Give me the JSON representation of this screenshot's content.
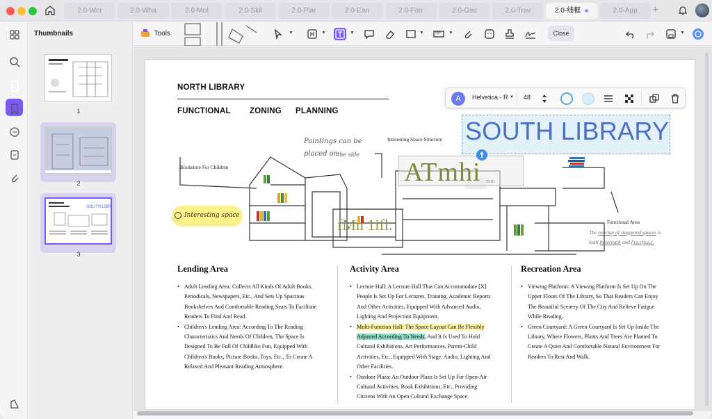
{
  "tabs": [
    {
      "label": "2.0-Wor"
    },
    {
      "label": "2.0-Wha"
    },
    {
      "label": "2.0-Mot"
    },
    {
      "label": "2.0-Skil"
    },
    {
      "label": "2.0-Plar"
    },
    {
      "label": "2.0-Earr"
    },
    {
      "label": "2.0-Forr"
    },
    {
      "label": "2.0-Gec"
    },
    {
      "label": "2.0-Trav"
    },
    {
      "label": "2.0-线框"
    },
    {
      "label": "2.0-App"
    }
  ],
  "sidebar": {
    "title": "Thumbnails",
    "pages": [
      "1",
      "2",
      "3"
    ]
  },
  "toolbar": {
    "tools_label": "Tools",
    "close_label": "Close"
  },
  "format_bar": {
    "font": "Helvetica - R",
    "size": "48",
    "avatar_letter": "A"
  },
  "doc": {
    "title": "NORTH LIBRARY",
    "subtitle": [
      "FUNCTIONAL",
      "ZONING",
      "PLANNING"
    ],
    "south_text": "SOUTH LIBRARY",
    "overlay_big": "ATmhi",
    "overlay_small": "mm",
    "overlay_mid": "fMn 1ifl.",
    "labels": {
      "bookstore": "Bookstore For Children",
      "paintings_1": "Paintings can be",
      "paintings_2": "placed on",
      "paintings_3": "the side",
      "interesting_struct": "Interesting Space Structure",
      "functional": "Functional Area",
      "interesting_space": "Interesting space",
      "overlap_1": "The",
      "overlap_2": "overlap of staggered spaces",
      "overlap_3": "is",
      "overlap_4": "both",
      "overlap_5": "ih-terestih",
      "overlap_6": "and",
      "overlap_7": "f'ra.cfica.l."
    },
    "sections": [
      {
        "heading": "Lending Area",
        "items": [
          "Adult Lending Area: Collects All Kinds Of Adult Books, Periodicals, Newspapers, Etc., And Sets Up Spacious Bookshelves And Comfortable Reading Seats To Facilitate Readers To Find And Read.",
          "Children's Lending Area: According To The Reading Characteristics And Needs Of Children, The Space Is Designed To Be Full Of Childlike Fun, Equipped With Children's Books, Picture Books, Toys, Etc., To Create A Relaxed And Pleasant Reading Atmosphere."
        ]
      },
      {
        "heading": "Activity Area",
        "items": [
          "Lecture Hall: A Lecture Hall That Can Accommodate [X] People Is Set Up For Lectures, Training, Academic Reports And Other Activities, Equipped With Advanced Audio, Lighting And Projection Equipment.",
          "HIGHLIGHT",
          "Outdoor Plaza: An Outdoor Plaza Is Set Up For Open-Air Cultural Activities, Book Exhibitions, Etc., Providing Citizens With An Open Cultural Exchange Space."
        ],
        "hl_yellow": "Multi-Function Hall: The Space Layout Can Be Flexibly",
        "hl_green": "Adjusted According To Needs",
        "hl_rest": ", And It Is Used To Hold Cultural Exhibitions, Art Performances, Parent-Child Activities, Etc., Equipped With Stage, Audio, Lighting And Other Facilities."
      },
      {
        "heading": "Recreation Area",
        "items": [
          "Viewing Platform: A Viewing Platform Is Set Up On The Upper Floors Of The Library, So That Readers Can Enjoy The Beautiful Scenery Of The City And Relieve Fatigue While Reading.",
          "Green Courtyard: A Green Courtyard Is Set Up Inside The Library, Where Flowers, Plants And Trees Are Planted To Create A Quiet And Comfortable Natural Environment For Readers To Rest And Walk."
        ]
      }
    ]
  },
  "colors": {
    "accent": "#7a5cf5",
    "south": "#4c6fc0",
    "highlight_yellow": "#fbf3a8",
    "highlight_green": "#8fdcc0"
  }
}
